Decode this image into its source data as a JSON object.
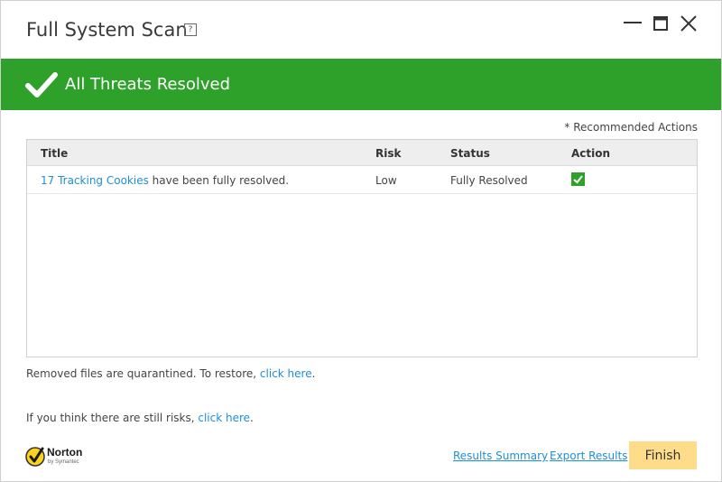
{
  "window": {
    "title": "Full System Scan",
    "help_label": "?"
  },
  "banner": {
    "text": "All Threats Resolved",
    "color": "#2ea12a"
  },
  "recommended_actions": "* Recommended Actions",
  "table": {
    "headers": {
      "title": "Title",
      "risk": "Risk",
      "status": "Status",
      "action": "Action"
    },
    "rows": [
      {
        "title_link": "17 Tracking Cookies",
        "title_rest": " have been fully resolved.",
        "risk": "Low",
        "status": "Fully Resolved",
        "action_icon": "check-icon"
      }
    ]
  },
  "notes": {
    "quarantine_text": "Removed files are quarantined. To restore, ",
    "quarantine_link": "click here",
    "quarantine_end": ".",
    "risks_text": "If you think there are still risks, ",
    "risks_link": "click here",
    "risks_end": "."
  },
  "logo": {
    "name": "Norton",
    "sub": "by Symantec"
  },
  "footer": {
    "results_summary": "Results Summary",
    "export_results": "Export Results",
    "finish": "Finish"
  },
  "colors": {
    "accent_green": "#2ea12a",
    "link_blue": "#1e8fd6",
    "finish_button": "#fedc8a"
  }
}
